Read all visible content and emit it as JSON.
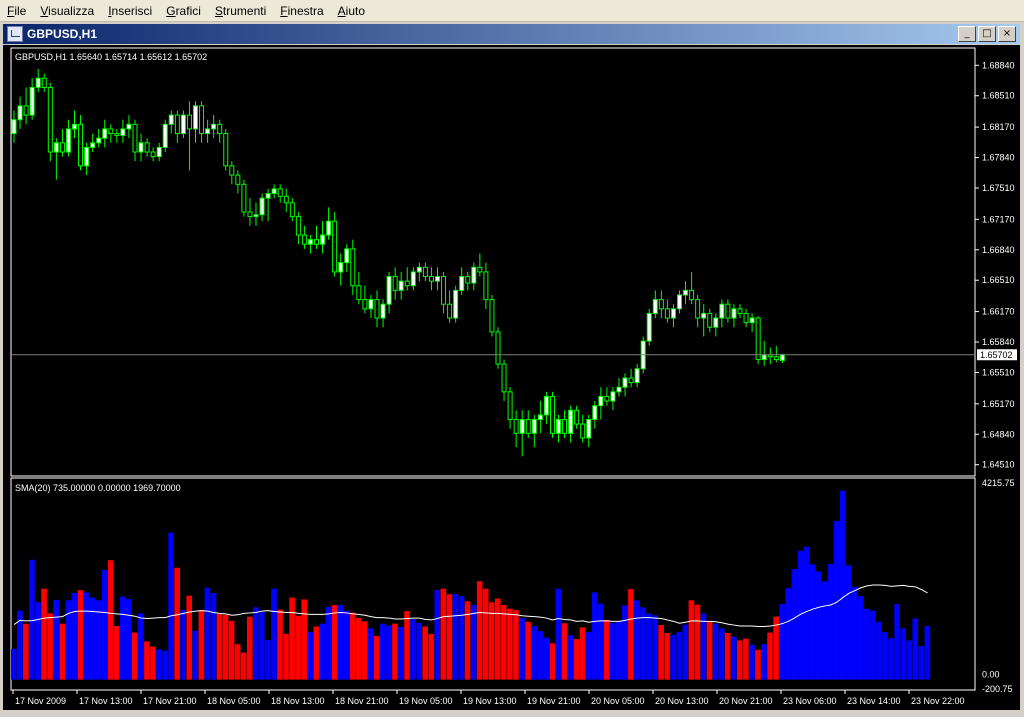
{
  "menu": [
    "File",
    "Visualizza",
    "Inserisci",
    "Grafici",
    "Strumenti",
    "Finestra",
    "Aiuto"
  ],
  "window": {
    "title": "GBPUSD,H1",
    "buttons": [
      "_",
      "□",
      "×"
    ]
  },
  "colors": {
    "bull": "#ffffff",
    "bear": "#000000",
    "wick": "#00ff00",
    "vol_up": "#0000ff",
    "vol_down": "#ff0000",
    "sma": "#ffffff",
    "grid": "#ffffff",
    "bid_line": "#808080",
    "background": "#000000"
  },
  "chart_data": [
    {
      "type": "candlestick",
      "title": "GBPUSD,H1  1.65640 1.65714 1.65612 1.65702",
      "y_ticks": [
        "1.68840",
        "1.68510",
        "1.68170",
        "1.67840",
        "1.67510",
        "1.67170",
        "1.66840",
        "1.66510",
        "1.66170",
        "1.65840",
        "1.65510",
        "1.65170",
        "1.64840",
        "1.64510"
      ],
      "y_range": [
        1.6442,
        1.6893
      ],
      "current_price": "1.65702",
      "x_tick_labels": [
        "17 Nov 2009",
        "17 Nov 13:00",
        "17 Nov 21:00",
        "18 Nov 05:00",
        "18 Nov 13:00",
        "18 Nov 21:00",
        "19 Nov 05:00",
        "19 Nov 13:00",
        "19 Nov 21:00",
        "20 Nov 05:00",
        "20 Nov 13:00",
        "20 Nov 21:00",
        "23 Nov 06:00",
        "23 Nov 14:00",
        "23 Nov 22:00"
      ],
      "ohlc": [
        [
          1.681,
          1.6835,
          1.68,
          1.6825
        ],
        [
          1.6825,
          1.685,
          1.6815,
          1.684
        ],
        [
          1.684,
          1.686,
          1.682,
          1.683
        ],
        [
          1.683,
          1.687,
          1.6825,
          1.686
        ],
        [
          1.686,
          1.688,
          1.6855,
          1.687
        ],
        [
          1.687,
          1.6875,
          1.6855,
          1.686
        ],
        [
          1.686,
          1.6865,
          1.678,
          1.679
        ],
        [
          1.679,
          1.6805,
          1.676,
          1.68
        ],
        [
          1.68,
          1.6815,
          1.6785,
          1.679
        ],
        [
          1.679,
          1.6825,
          1.6785,
          1.6815
        ],
        [
          1.6815,
          1.6835,
          1.6805,
          1.682
        ],
        [
          1.682,
          1.683,
          1.677,
          1.6775
        ],
        [
          1.6775,
          1.68,
          1.6765,
          1.6795
        ],
        [
          1.6795,
          1.681,
          1.679,
          1.68
        ],
        [
          1.68,
          1.6815,
          1.6795,
          1.6805
        ],
        [
          1.6805,
          1.6825,
          1.6795,
          1.6815
        ],
        [
          1.6815,
          1.682,
          1.68,
          1.681
        ],
        [
          1.681,
          1.6815,
          1.68,
          1.6808
        ],
        [
          1.6808,
          1.6825,
          1.68,
          1.6815
        ],
        [
          1.6815,
          1.683,
          1.6805,
          1.682
        ],
        [
          1.682,
          1.6825,
          1.678,
          1.679
        ],
        [
          1.679,
          1.681,
          1.678,
          1.68
        ],
        [
          1.68,
          1.6805,
          1.6785,
          1.679
        ],
        [
          1.679,
          1.6795,
          1.678,
          1.6785
        ],
        [
          1.6785,
          1.68,
          1.678,
          1.6795
        ],
        [
          1.6795,
          1.6825,
          1.679,
          1.682
        ],
        [
          1.682,
          1.6835,
          1.681,
          1.683
        ],
        [
          1.683,
          1.6835,
          1.68,
          1.681
        ],
        [
          1.681,
          1.6835,
          1.6805,
          1.683
        ],
        [
          1.683,
          1.6845,
          1.677,
          1.6815
        ],
        [
          1.6815,
          1.6845,
          1.68,
          1.684
        ],
        [
          1.684,
          1.6845,
          1.68,
          1.681
        ],
        [
          1.681,
          1.6825,
          1.68,
          1.6815
        ],
        [
          1.6815,
          1.683,
          1.6805,
          1.682
        ],
        [
          1.682,
          1.6825,
          1.68,
          1.681
        ],
        [
          1.681,
          1.6815,
          1.677,
          1.6775
        ],
        [
          1.6775,
          1.678,
          1.6755,
          1.6765
        ],
        [
          1.6765,
          1.677,
          1.6745,
          1.6755
        ],
        [
          1.6755,
          1.676,
          1.672,
          1.6725
        ],
        [
          1.6725,
          1.674,
          1.671,
          1.672
        ],
        [
          1.672,
          1.6735,
          1.671,
          1.6722
        ],
        [
          1.6722,
          1.6745,
          1.6715,
          1.674
        ],
        [
          1.674,
          1.675,
          1.6715,
          1.6745
        ],
        [
          1.6745,
          1.6755,
          1.674,
          1.675
        ],
        [
          1.675,
          1.6755,
          1.6735,
          1.6742
        ],
        [
          1.6742,
          1.675,
          1.6725,
          1.6735
        ],
        [
          1.6735,
          1.674,
          1.6715,
          1.672
        ],
        [
          1.672,
          1.6725,
          1.669,
          1.67
        ],
        [
          1.67,
          1.671,
          1.6685,
          1.669
        ],
        [
          1.669,
          1.67,
          1.668,
          1.6695
        ],
        [
          1.6695,
          1.671,
          1.6685,
          1.669
        ],
        [
          1.669,
          1.6715,
          1.668,
          1.67
        ],
        [
          1.67,
          1.673,
          1.6695,
          1.6715
        ],
        [
          1.6715,
          1.6725,
          1.6655,
          1.666
        ],
        [
          1.666,
          1.668,
          1.6645,
          1.667
        ],
        [
          1.667,
          1.669,
          1.666,
          1.6685
        ],
        [
          1.6685,
          1.6695,
          1.6635,
          1.6645
        ],
        [
          1.6645,
          1.666,
          1.6625,
          1.663
        ],
        [
          1.663,
          1.6645,
          1.6615,
          1.662
        ],
        [
          1.662,
          1.6635,
          1.661,
          1.663
        ],
        [
          1.663,
          1.664,
          1.66,
          1.661
        ],
        [
          1.661,
          1.663,
          1.66,
          1.6625
        ],
        [
          1.6625,
          1.666,
          1.6615,
          1.6655
        ],
        [
          1.6655,
          1.6665,
          1.663,
          1.664
        ],
        [
          1.664,
          1.666,
          1.663,
          1.665
        ],
        [
          1.665,
          1.6665,
          1.664,
          1.6645
        ],
        [
          1.6645,
          1.6665,
          1.664,
          1.666
        ],
        [
          1.666,
          1.667,
          1.665,
          1.6665
        ],
        [
          1.6665,
          1.667,
          1.665,
          1.6655
        ],
        [
          1.6655,
          1.6665,
          1.664,
          1.665
        ],
        [
          1.665,
          1.6665,
          1.664,
          1.6655
        ],
        [
          1.6655,
          1.666,
          1.6615,
          1.6625
        ],
        [
          1.6625,
          1.664,
          1.6605,
          1.661
        ],
        [
          1.661,
          1.6645,
          1.6605,
          1.664
        ],
        [
          1.664,
          1.6665,
          1.6635,
          1.6655
        ],
        [
          1.6655,
          1.666,
          1.664,
          1.6648
        ],
        [
          1.6648,
          1.667,
          1.664,
          1.6665
        ],
        [
          1.6665,
          1.668,
          1.6655,
          1.666
        ],
        [
          1.666,
          1.667,
          1.662,
          1.663
        ],
        [
          1.663,
          1.6635,
          1.659,
          1.6595
        ],
        [
          1.6595,
          1.66,
          1.6555,
          1.656
        ],
        [
          1.656,
          1.6565,
          1.652,
          1.653
        ],
        [
          1.653,
          1.6535,
          1.649,
          1.65
        ],
        [
          1.65,
          1.651,
          1.647,
          1.6485
        ],
        [
          1.6485,
          1.651,
          1.646,
          1.65
        ],
        [
          1.65,
          1.651,
          1.648,
          1.6485
        ],
        [
          1.6485,
          1.6505,
          1.647,
          1.65
        ],
        [
          1.65,
          1.652,
          1.6485,
          1.6505
        ],
        [
          1.6505,
          1.653,
          1.6495,
          1.6525
        ],
        [
          1.6525,
          1.653,
          1.648,
          1.6485
        ],
        [
          1.6485,
          1.6505,
          1.6475,
          1.65
        ],
        [
          1.65,
          1.651,
          1.648,
          1.6485
        ],
        [
          1.6485,
          1.6515,
          1.6475,
          1.651
        ],
        [
          1.651,
          1.6515,
          1.649,
          1.6495
        ],
        [
          1.6495,
          1.6505,
          1.6475,
          1.648
        ],
        [
          1.648,
          1.6505,
          1.647,
          1.65
        ],
        [
          1.65,
          1.652,
          1.649,
          1.6515
        ],
        [
          1.6515,
          1.6535,
          1.65,
          1.6525
        ],
        [
          1.6525,
          1.6535,
          1.6515,
          1.652
        ],
        [
          1.652,
          1.6535,
          1.651,
          1.653
        ],
        [
          1.653,
          1.6545,
          1.6525,
          1.6535
        ],
        [
          1.6535,
          1.655,
          1.6525,
          1.6545
        ],
        [
          1.6545,
          1.6555,
          1.6535,
          1.654
        ],
        [
          1.654,
          1.656,
          1.6535,
          1.6555
        ],
        [
          1.6555,
          1.659,
          1.655,
          1.6585
        ],
        [
          1.6585,
          1.662,
          1.658,
          1.6615
        ],
        [
          1.6615,
          1.664,
          1.661,
          1.663
        ],
        [
          1.663,
          1.664,
          1.661,
          1.662
        ],
        [
          1.662,
          1.663,
          1.6605,
          1.661
        ],
        [
          1.661,
          1.6625,
          1.66,
          1.662
        ],
        [
          1.662,
          1.664,
          1.6615,
          1.6635
        ],
        [
          1.6635,
          1.665,
          1.6625,
          1.664
        ],
        [
          1.664,
          1.666,
          1.6625,
          1.663
        ],
        [
          1.663,
          1.6635,
          1.66,
          1.661
        ],
        [
          1.661,
          1.6625,
          1.659,
          1.6615
        ],
        [
          1.6615,
          1.662,
          1.6595,
          1.66
        ],
        [
          1.66,
          1.6615,
          1.659,
          1.661
        ],
        [
          1.661,
          1.663,
          1.66,
          1.6625
        ],
        [
          1.6625,
          1.663,
          1.6605,
          1.661
        ],
        [
          1.661,
          1.6625,
          1.66,
          1.662
        ],
        [
          1.662,
          1.6625,
          1.661,
          1.6615
        ],
        [
          1.6615,
          1.662,
          1.66,
          1.6605
        ],
        [
          1.6605,
          1.6615,
          1.6595,
          1.661
        ],
        [
          1.661,
          1.6612,
          1.656,
          1.6565
        ],
        [
          1.6565,
          1.6585,
          1.6558,
          1.657
        ],
        [
          1.657,
          1.6578,
          1.656,
          1.6568
        ],
        [
          1.6568,
          1.658,
          1.6562,
          1.6565
        ],
        [
          1.6564,
          1.65714,
          1.65612,
          1.65702
        ]
      ]
    },
    {
      "type": "bar",
      "title": "SMA(20) 735.00000 0.00000 1969.70000",
      "y_ticks": [
        "4215.75",
        "0.00",
        "-200.75"
      ],
      "y_range": [
        -200.75,
        4215.75
      ],
      "volumes": [
        660,
        1480,
        1200,
        2570,
        1660,
        1950,
        1420,
        1710,
        1200,
        1700,
        1860,
        1920,
        1870,
        1760,
        1700,
        2350,
        2560,
        1150,
        1780,
        1730,
        1010,
        1420,
        820,
        710,
        650,
        620,
        3150,
        2400,
        1490,
        1800,
        1050,
        1490,
        1970,
        1860,
        1410,
        1390,
        1260,
        760,
        580,
        1350,
        1550,
        1450,
        850,
        1950,
        1500,
        980,
        1760,
        1370,
        1720,
        1020,
        1140,
        1200,
        1560,
        1600,
        1600,
        1480,
        1440,
        1320,
        1250,
        1100,
        940,
        1200,
        1160,
        1200,
        1130,
        1470,
        1300,
        1220,
        1140,
        980,
        1920,
        1950,
        1830,
        1840,
        1790,
        1680,
        1600,
        2110,
        1950,
        1660,
        1740,
        1600,
        1520,
        1490,
        1320,
        1240,
        1150,
        1040,
        900,
        780,
        1950,
        1210,
        950,
        870,
        1120,
        1020,
        1870,
        1630,
        1280,
        1210,
        1250,
        1590,
        1940,
        1700,
        1550,
        1420,
        1380,
        1170,
        1000,
        960,
        1020,
        1180,
        1700,
        1610,
        1420,
        1240,
        1200,
        1100,
        1000,
        920,
        840,
        880,
        750,
        640,
        760,
        1010,
        1350,
        1620,
        1960,
        2370,
        2760,
        2850,
        2470,
        2320,
        2110,
        2480,
        3400,
        4050,
        2450,
        1990,
        1790,
        1520,
        1480,
        1240,
        1020,
        890,
        1620,
        1100,
        840,
        1310,
        720,
        1150
      ],
      "sma": [
        1180,
        1270,
        1260,
        1265,
        1290,
        1320,
        1330,
        1340,
        1350,
        1420,
        1460,
        1470,
        1470,
        1460,
        1450,
        1440,
        1420,
        1410,
        1400,
        1380,
        1360,
        1320,
        1310,
        1320,
        1330,
        1330,
        1370,
        1390,
        1420,
        1450,
        1470,
        1480,
        1470,
        1440,
        1420,
        1410,
        1380,
        1390,
        1420,
        1430,
        1440,
        1470,
        1480,
        1460,
        1450,
        1440,
        1440,
        1420,
        1410,
        1400,
        1400,
        1400,
        1410,
        1430,
        1440,
        1430,
        1410,
        1400,
        1380,
        1350,
        1330,
        1330,
        1320,
        1300,
        1300,
        1310,
        1320,
        1320,
        1290,
        1280,
        1310,
        1350,
        1360,
        1370,
        1380,
        1400,
        1420,
        1440,
        1430,
        1420,
        1420,
        1410,
        1400,
        1390,
        1370,
        1360,
        1350,
        1340,
        1320,
        1280,
        1310,
        1290,
        1280,
        1250,
        1260,
        1230,
        1250,
        1260,
        1260,
        1250,
        1250,
        1270,
        1300,
        1320,
        1330,
        1330,
        1320,
        1310,
        1280,
        1250,
        1210,
        1230,
        1260,
        1260,
        1250,
        1250,
        1240,
        1220,
        1190,
        1170,
        1150,
        1150,
        1150,
        1140,
        1140,
        1150,
        1170,
        1200,
        1250,
        1320,
        1400,
        1460,
        1510,
        1550,
        1580,
        1600,
        1660,
        1760,
        1850,
        1910,
        1970,
        2010,
        2030,
        2030,
        2020,
        2000,
        2010,
        2020,
        2000,
        1990,
        1930,
        1860
      ]
    }
  ]
}
